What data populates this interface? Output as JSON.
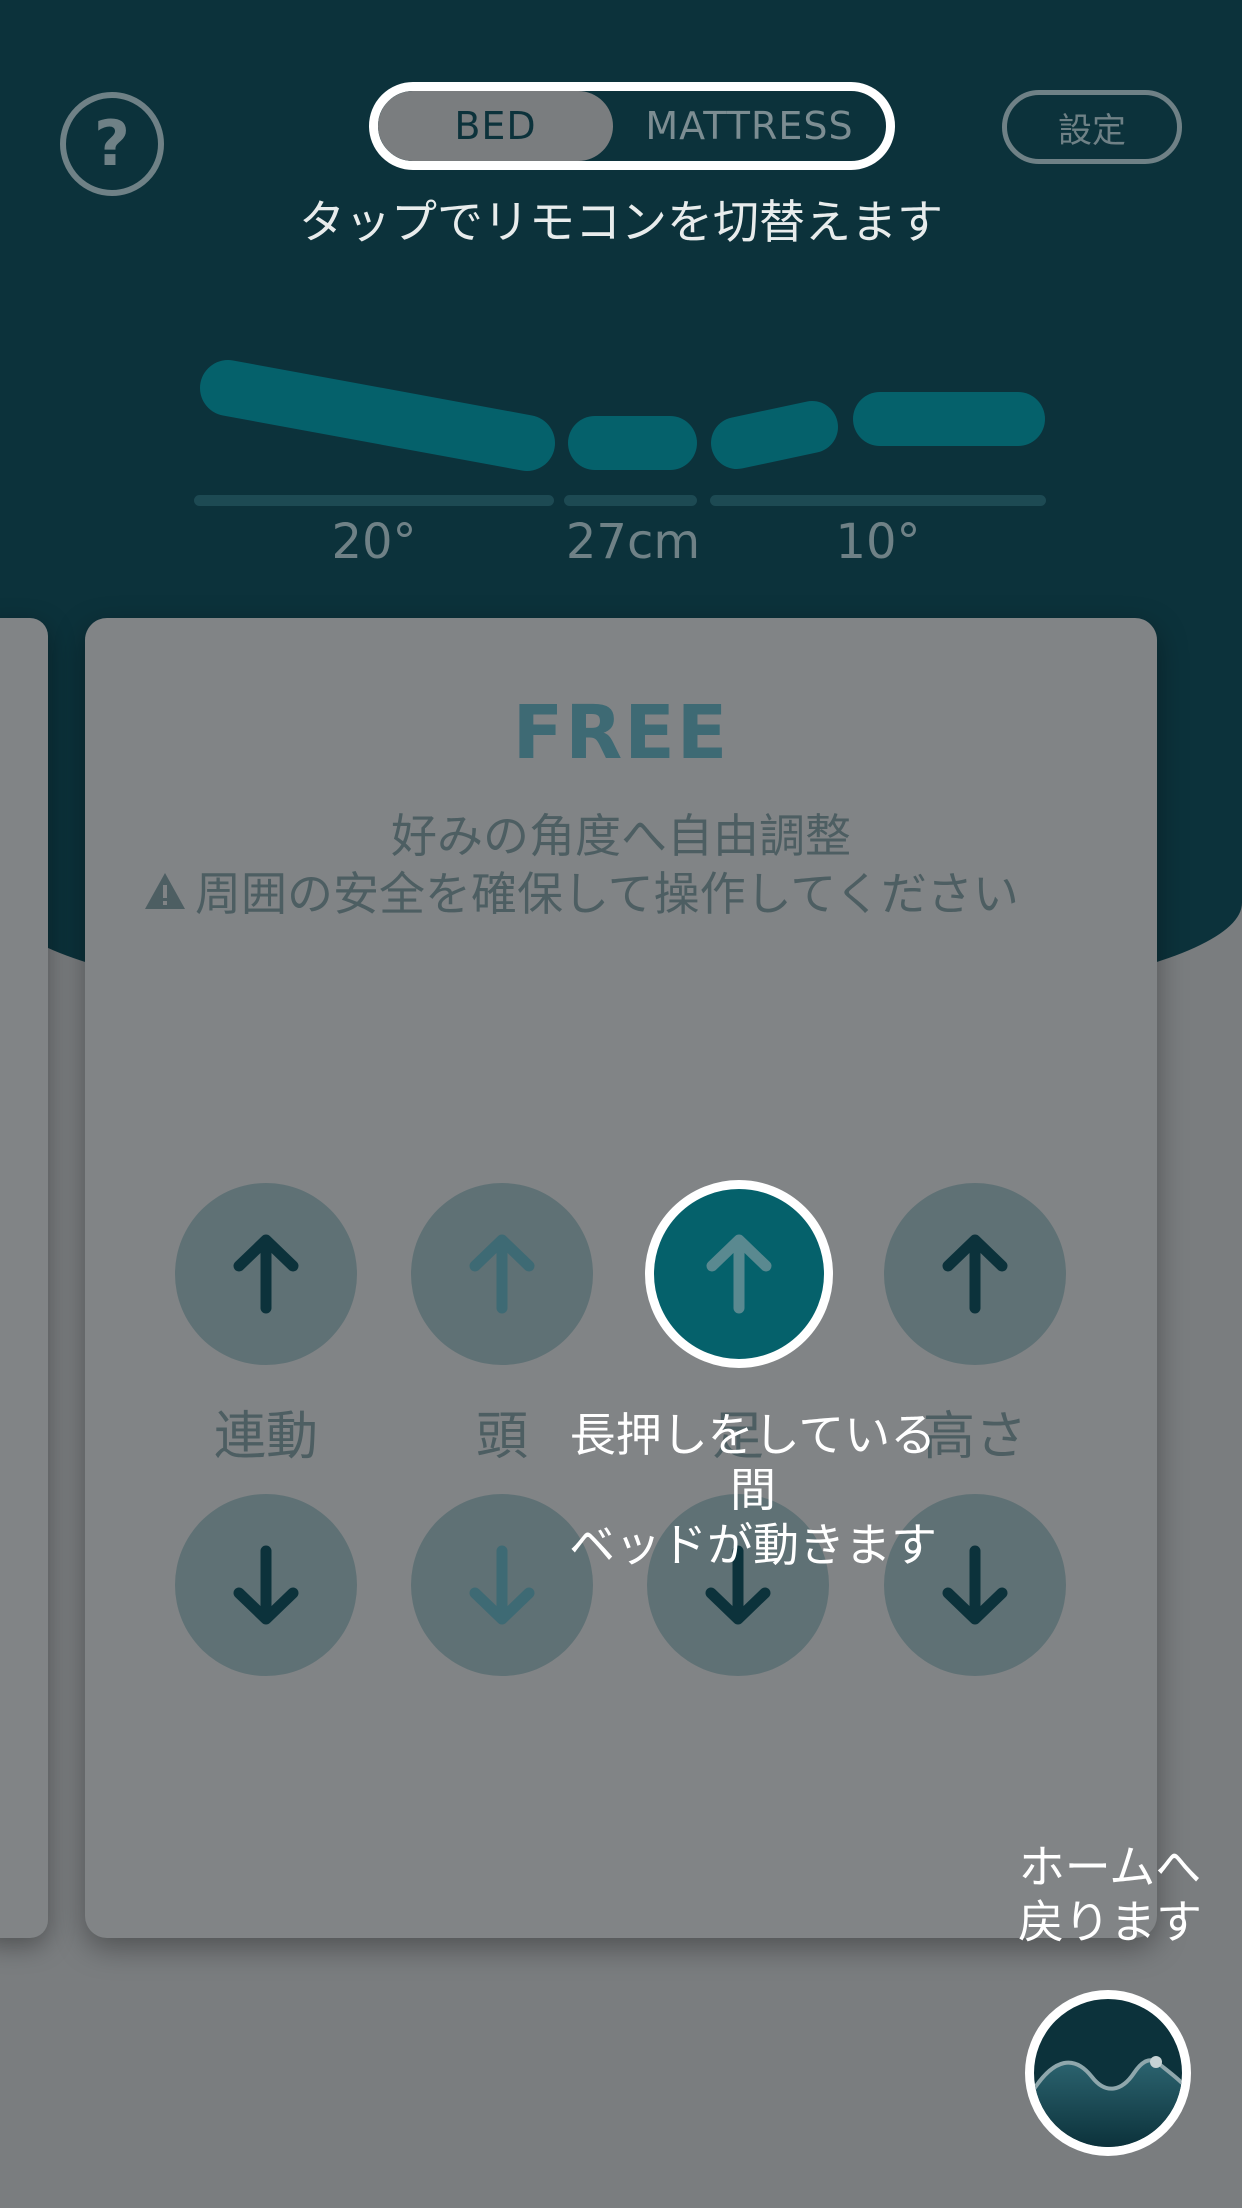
{
  "top_bar": {
    "help_label": "?",
    "segment": {
      "bed_label": "BED",
      "mattress_label": "MATTRESS"
    },
    "settings_label": "設定",
    "switch_hint": "タップでリモコンを切替えます"
  },
  "bed_position": {
    "head_angle": "20°",
    "height": "27cm",
    "foot_angle": "10°"
  },
  "mode_card": {
    "title": "FREE",
    "description": "好みの角度へ自由調整",
    "warning": "周囲の安全を確保して操作してください"
  },
  "controls": [
    {
      "label": "連動"
    },
    {
      "label": "頭"
    },
    {
      "label": "足"
    },
    {
      "label": "高さ"
    }
  ],
  "tutorial": {
    "hold_tip": [
      "長押しをしている間",
      "ベッドが動きます"
    ],
    "home_tip": [
      "ホームへ",
      "戻ります"
    ]
  },
  "colors": {
    "header_bg": "#0c323b",
    "accent": "#05616b",
    "overlay_gray": "#7a7d7f"
  },
  "icons": {
    "help": "question-circle",
    "up": "arrow-up",
    "down": "arrow-down",
    "home": "wave-mountain",
    "warning": "warning-triangle"
  }
}
